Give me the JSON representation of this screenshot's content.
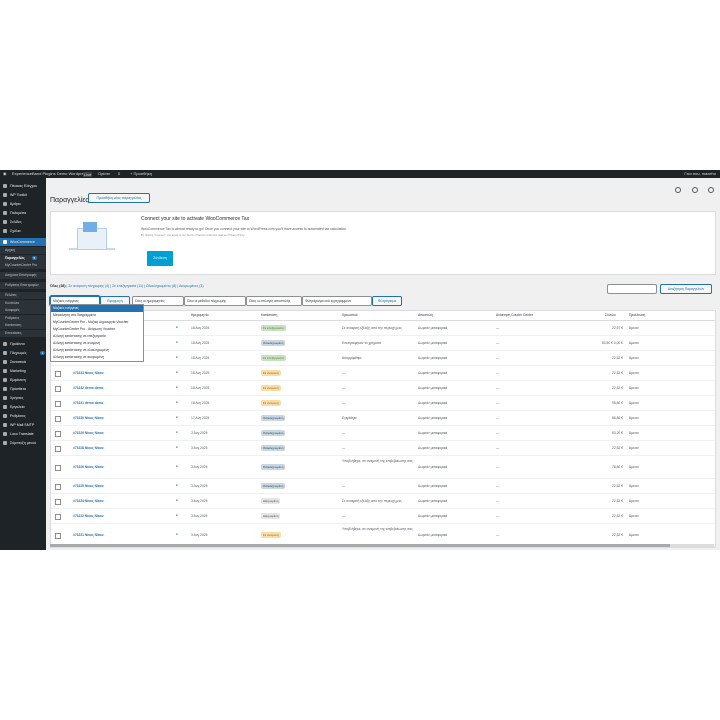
{
  "adminbar": {
    "site": "ExperienceBand Plugins Demo Wordpress",
    "site_badge": "Live",
    "comments": "Ορίστε",
    "updates": "0",
    "new": "+ Προσθήκη",
    "user": "Γεια σου, maxeho"
  },
  "sidebar": {
    "items_top": [
      {
        "label": "Πίνακας Ελέγχου",
        "icon": "dashboard-icon"
      },
      {
        "label": "WP Toolkit",
        "icon": "toolkit-icon"
      },
      {
        "label": "Άρθρα",
        "icon": "pin-icon"
      },
      {
        "label": "Πολυμέσα",
        "icon": "media-icon"
      },
      {
        "label": "Σελίδες",
        "icon": "page-icon"
      },
      {
        "label": "Σχόλια",
        "icon": "comment-icon"
      }
    ],
    "woocommerce": "WooCommerce",
    "submenu": [
      {
        "label": "Αρχική",
        "current": false
      },
      {
        "label": "Παραγγελίες",
        "current": true,
        "badge": "5"
      },
      {
        "label": "MyCounterCenter Pro",
        "current": false
      },
      {
        "label": "Αιτήματα Επιστροφής",
        "current": false
      },
      {
        "label": "Ρυθμίσεις Επιστροφών",
        "current": false
      },
      {
        "label": "Πελάτες",
        "current": false
      },
      {
        "label": "Κουπόνια",
        "current": false
      },
      {
        "label": "Αναφορές",
        "current": false
      },
      {
        "label": "Ρυθμίσεις",
        "current": false
      },
      {
        "label": "Κατάσταση",
        "current": false
      },
      {
        "label": "Επεκτάσεις",
        "current": false
      }
    ],
    "items_bottom": [
      {
        "label": "Προϊόντα",
        "icon": "product-icon",
        "badge": ""
      },
      {
        "label": "Πληρωμές",
        "icon": "payment-icon",
        "badge": "1"
      },
      {
        "label": "Στατιστικά",
        "icon": "chart-icon",
        "badge": ""
      },
      {
        "label": "Marketing",
        "icon": "megaphone-icon",
        "badge": ""
      },
      {
        "label": "Εμφάνιση",
        "icon": "brush-icon",
        "badge": ""
      },
      {
        "label": "Πρόσθετα",
        "icon": "plugin-icon",
        "badge": ""
      },
      {
        "label": "Χρήστες",
        "icon": "users-icon",
        "badge": ""
      },
      {
        "label": "Εργαλεία",
        "icon": "tools-icon",
        "badge": ""
      },
      {
        "label": "Ρυθμίσεις",
        "icon": "settings-icon",
        "badge": ""
      },
      {
        "label": "WP Mail SMTP",
        "icon": "mail-icon",
        "badge": ""
      },
      {
        "label": "Loco Translate",
        "icon": "translate-icon",
        "badge": ""
      },
      {
        "label": "Σύμπτυξη μενού",
        "icon": "collapse-icon",
        "badge": ""
      }
    ]
  },
  "page": {
    "title": "Παραγγελίες",
    "add_new": "Προσθήκη νέας παραγγελίας"
  },
  "notice": {
    "title": "Connect your site to activate WooCommerce Tax",
    "text": "WooCommerce Tax is almost ready to go! Once you connect your site to WordPress.com you'll have access to automated tax calculation.",
    "small": "By clicking \"Connect\", you agree to our Terms of Service and have read our Privacy Policy.",
    "button": "Σύνδεση"
  },
  "views": {
    "all": "Όλες (38)",
    "rest": "| Σε αναμονή πληρωμής (4) | Σε επεξεργασία (11) | Ολοκληρωμένες (8) | Ακυρωμένες (3)"
  },
  "search": {
    "button": "Αναζήτηση Παραγγελιών"
  },
  "filters": {
    "bulk": "Μαζικές ενέργειες",
    "apply": "Εφαρμογή",
    "dates": "Όλες οι ημερομηνίες",
    "payment": "Όλοι οι μέθοδοι πληρωμής",
    "shipping": "Όλες οι επιλογές αποστολής",
    "customer": "Φιλτράρισμα ανά εγγεγραμμένο",
    "filter": "Φιλτράρισμα"
  },
  "dropdown": [
    "Μαζικές ενέργειες",
    "Μετακίνηση στα διαγραμμένα",
    "MyCounterCenter Pro - Μαζική Δημιουργία Voucher",
    "MyCounterCenter Pro - Ακύρωση Voucher",
    "Αλλαγή κατάστασης σε επεξεργασία",
    "Αλλαγή κατάστασης σε αναμονή",
    "Αλλαγή κατάστασης σε ολοκληρωμένη",
    "Αλλαγή κατάστασης σε ακυρωμένη"
  ],
  "table": {
    "headers": [
      "Ημερομηνία",
      "Κατάσταση",
      "Χρεωστικό",
      "Αποστολή",
      "Ανάκτηση Courier Center",
      "Σύνολο",
      "Προέλευση"
    ],
    "rows": [
      {
        "order": "",
        "date": "18 Αυγ 2025",
        "status": "Σε επεξεργασία",
        "cls": "completed",
        "billing": "Σε ανακριτή εξέλιξη από την περιοχή μας",
        "ship": "Δωρεάν μεταφορικά",
        "courier": "—",
        "total": "22,57 €",
        "origin": "Άμεσα",
        "tall": false
      },
      {
        "order": "",
        "date": "18 Αυγ 2025",
        "status": "Ολοκληρωμένη",
        "cls": "processing",
        "billing": "Επιστράφηκαν τα χρήματα",
        "ship": "Δωρεάν μεταφορικά",
        "courier": "—",
        "total": "83,50 € 0,00 €",
        "origin": "Άμεσα",
        "tall": false
      },
      {
        "order": "",
        "date": "18 Αυγ 2025",
        "status": "Σε επεξεργασία",
        "cls": "completed",
        "billing": "Απορρίφθηκε",
        "ship": "Δωρεάν μεταφορικά",
        "courier": "—",
        "total": "22,52 €",
        "origin": "Άμεσα",
        "tall": false
      },
      {
        "order": "#73233 Νίκος Νίκου",
        "date": "18 Αυγ 2025",
        "status": "Σε αναμονή",
        "cls": "onhold",
        "billing": "—",
        "ship": "Δωρεάν μεταφορικά",
        "courier": "—",
        "total": "22,52 €",
        "origin": "Άμεσα",
        "tall": false
      },
      {
        "order": "#73232 demo demo",
        "date": "18 Αυγ 2025",
        "status": "Σε αναμονή",
        "cls": "onhold",
        "billing": "—",
        "ship": "Δωρεάν μεταφορικά",
        "courier": "—",
        "total": "22,52 €",
        "origin": "Άμεσα",
        "tall": false
      },
      {
        "order": "#73231 demo demo",
        "date": "18 Αυγ 2025",
        "status": "Σε αναμονή",
        "cls": "onhold",
        "billing": "—",
        "ship": "Δωρεάν μεταφορικά",
        "courier": "—",
        "total": "95,80 €",
        "origin": "Άμεσα",
        "tall": false
      },
      {
        "order": "#73230 Νίκος Νίκου",
        "date": "17 Αυγ 2025",
        "status": "Ολοκληρωμένη",
        "cls": "processing",
        "billing": "Εγκρίθηκε",
        "ship": "Δωρεάν μεταφορικά",
        "courier": "—",
        "total": "86,80 €",
        "origin": "Άμεσα",
        "tall": false
      },
      {
        "order": "#73229 Νίκος Νίκου",
        "date": "3 Αυγ 2025",
        "status": "Ολοκληρωμένη",
        "cls": "processing",
        "billing": "—",
        "ship": "Δωρεάν μεταφορικά",
        "courier": "—",
        "total": "53,20 €",
        "origin": "Άμεσα",
        "tall": false
      },
      {
        "order": "#73228 Νίκος Νίκου",
        "date": "3 Αυγ 2025",
        "status": "Ολοκληρωμένη",
        "cls": "processing",
        "billing": "—",
        "ship": "Δωρεάν μεταφορικά",
        "courier": "—",
        "total": "22,52 €",
        "origin": "Άμεσα",
        "tall": false
      },
      {
        "order": "#73226 Νίκος Νίκου",
        "date": "3 Αυγ 2025",
        "status": "Ολοκληρωμένη",
        "cls": "processing",
        "billing": "Υποβλήθηκε, σε αναμονή της επιβεβαίωσης σας",
        "ship": "Δωρεάν μεταφορικά",
        "courier": "—",
        "total": "78,80 €",
        "origin": "Άμεσα",
        "tall": true
      },
      {
        "order": "#73225 Νίκος Νίκου",
        "date": "3 Αυγ 2025",
        "status": "Ολοκληρωμένη",
        "cls": "processing",
        "billing": "—",
        "ship": "Δωρεάν μεταφορικά",
        "courier": "—",
        "total": "22,52 €",
        "origin": "Άμεσα",
        "tall": false
      },
      {
        "order": "#73224 Νίκος Νίκου",
        "date": "3 Αυγ 2025",
        "status": "Ακυρωμένη",
        "cls": "cancelled",
        "billing": "Σε ανακριτή εξέλιξη από την περιοχή μας",
        "ship": "Δωρεάν μεταφορικά",
        "courier": "—",
        "total": "22,52 €",
        "origin": "Άμεσα",
        "tall": false
      },
      {
        "order": "#73222 Νίκος Νίκου",
        "date": "3 Αυγ 2025",
        "status": "Ακυρωμένη",
        "cls": "cancelled",
        "billing": "—",
        "ship": "Δωρεάν μεταφορικά",
        "courier": "—",
        "total": "22,52 €",
        "origin": "Άμεσα",
        "tall": false
      },
      {
        "order": "#73221 Νίκος Νίκου",
        "date": "3 Αυγ 2025",
        "status": "Σε αναμονή",
        "cls": "onhold",
        "billing": "Υποβλήθηκε, σε αναμονή της επιβεβαίωσης σας",
        "ship": "Δωρεάν μεταφορικά",
        "courier": "—",
        "total": "22,52 €",
        "origin": "Άμεσα",
        "tall": true
      }
    ]
  }
}
